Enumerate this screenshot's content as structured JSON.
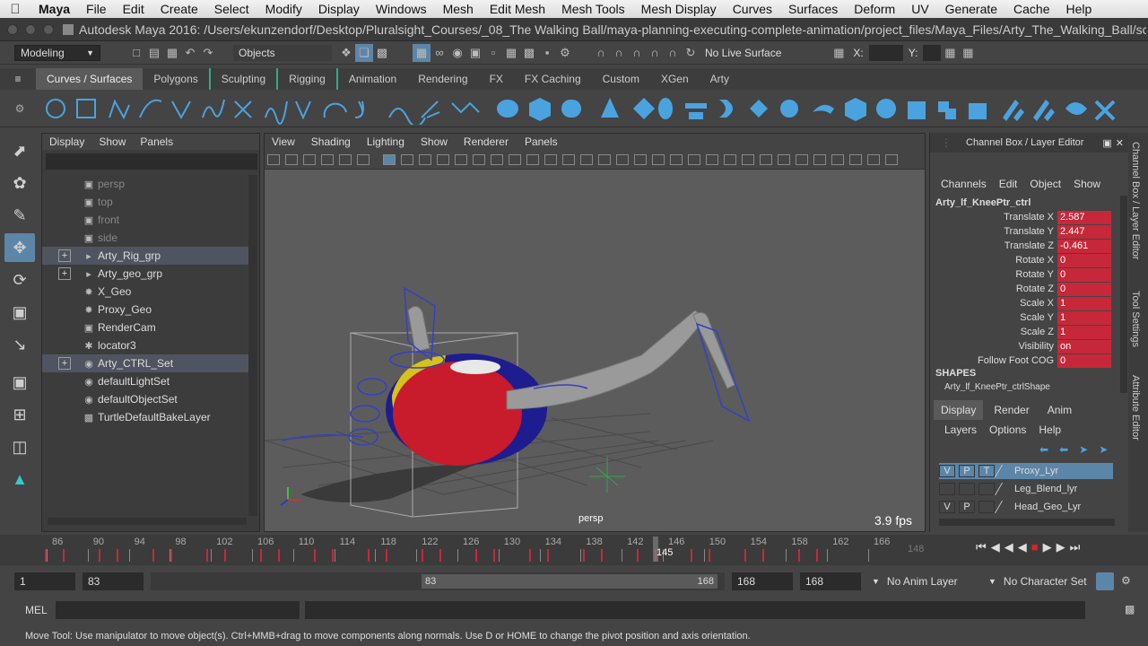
{
  "mac_menu": {
    "app_name": "Maya",
    "items": [
      "File",
      "Edit",
      "Create",
      "Select",
      "Modify",
      "Display",
      "Windows",
      "Mesh",
      "Edit Mesh",
      "Mesh Tools",
      "Mesh Display",
      "Curves",
      "Surfaces",
      "Deform",
      "UV",
      "Generate",
      "Cache",
      "Help"
    ]
  },
  "window": {
    "title": "Autodesk Maya 2016: /Users/ekunzendorf/Desktop/Pluralsight_Courses/_08_The Walking Ball/maya-planning-executing-complete-animation/project_files/Maya_Files/Arty_The_Walking_Ball/scen..."
  },
  "status_line": {
    "menu_set": "Modeling",
    "selection_mode": "Objects",
    "live_surface": "No Live Surface",
    "x_label": "X:",
    "y_label": "Y:"
  },
  "shelf": {
    "tabs": [
      "Curves / Surfaces",
      "Polygons",
      "Sculpting",
      "Rigging",
      "Animation",
      "Rendering",
      "FX",
      "FX Caching",
      "Custom",
      "XGen",
      "Arty"
    ],
    "active_tab": "Curves / Surfaces"
  },
  "outliner": {
    "menu": [
      "Display",
      "Show",
      "Panels"
    ],
    "items": [
      {
        "label": "persp",
        "icon": "camera-icon",
        "dim": true,
        "expand": false,
        "selected": false
      },
      {
        "label": "top",
        "icon": "camera-icon",
        "dim": true,
        "expand": false,
        "selected": false
      },
      {
        "label": "front",
        "icon": "camera-icon",
        "dim": true,
        "expand": false,
        "selected": false
      },
      {
        "label": "side",
        "icon": "camera-icon",
        "dim": true,
        "expand": false,
        "selected": false
      },
      {
        "label": "Arty_Rig_grp",
        "icon": "group-icon",
        "dim": false,
        "expand": true,
        "selected": true
      },
      {
        "label": "Arty_geo_grp",
        "icon": "group-icon",
        "dim": false,
        "expand": true,
        "selected": false
      },
      {
        "label": "X_Geo",
        "icon": "mesh-icon",
        "dim": false,
        "expand": false,
        "selected": false
      },
      {
        "label": "Proxy_Geo",
        "icon": "mesh-icon",
        "dim": false,
        "expand": false,
        "selected": false
      },
      {
        "label": "RenderCam",
        "icon": "camera-icon",
        "dim": false,
        "expand": false,
        "selected": false
      },
      {
        "label": "locator3",
        "icon": "locator-icon",
        "dim": false,
        "expand": false,
        "selected": false
      },
      {
        "label": "Arty_CTRL_Set",
        "icon": "set-icon",
        "dim": false,
        "expand": true,
        "selected": true
      },
      {
        "label": "defaultLightSet",
        "icon": "set-icon",
        "dim": false,
        "expand": false,
        "selected": false
      },
      {
        "label": "defaultObjectSet",
        "icon": "set-icon",
        "dim": false,
        "expand": false,
        "selected": false
      },
      {
        "label": "TurtleDefaultBakeLayer",
        "icon": "layer-icon",
        "dim": false,
        "expand": false,
        "selected": false
      }
    ]
  },
  "viewport": {
    "menu": [
      "View",
      "Shading",
      "Lighting",
      "Show",
      "Renderer",
      "Panels"
    ],
    "camera": "persp",
    "fps": "3.9 fps"
  },
  "channel_box": {
    "title": "Channel Box / Layer Editor",
    "menu": [
      "Channels",
      "Edit",
      "Object",
      "Show"
    ],
    "node": "Arty_lf_KneePtr_ctrl",
    "channels": [
      {
        "label": "Translate X",
        "value": "2.587"
      },
      {
        "label": "Translate Y",
        "value": "2.447"
      },
      {
        "label": "Translate Z",
        "value": "-0.461"
      },
      {
        "label": "Rotate X",
        "value": "0"
      },
      {
        "label": "Rotate Y",
        "value": "0"
      },
      {
        "label": "Rotate Z",
        "value": "0"
      },
      {
        "label": "Scale X",
        "value": "1"
      },
      {
        "label": "Scale Y",
        "value": "1"
      },
      {
        "label": "Scale Z",
        "value": "1"
      },
      {
        "label": "Visibility",
        "value": "on"
      },
      {
        "label": "Follow Foot COG",
        "value": "0"
      }
    ],
    "shapes_header": "SHAPES",
    "shape_name": "Arty_lf_KneePtr_ctrlShape",
    "layer_tabs": [
      "Display",
      "Render",
      "Anim"
    ],
    "active_layer_tab": "Display",
    "layer_menu": [
      "Layers",
      "Options",
      "Help"
    ],
    "layers": [
      {
        "name": "Proxy_Lyr",
        "v": "V",
        "p": "P",
        "t": "T",
        "selected": true
      },
      {
        "name": "Leg_Blend_lyr",
        "v": "",
        "p": "",
        "t": "",
        "selected": false
      },
      {
        "name": "Head_Geo_Lyr",
        "v": "V",
        "p": "P",
        "t": "",
        "selected": false
      }
    ],
    "side_tabs": [
      "Channel Box / Layer Editor",
      "Tool Settings",
      "Attribute Editor"
    ]
  },
  "timeline": {
    "ticks": [
      "86",
      "90",
      "94",
      "98",
      "102",
      "106",
      "110",
      "114",
      "118",
      "122",
      "126",
      "130",
      "134",
      "138",
      "142",
      "146",
      "150",
      "154",
      "158",
      "162",
      "166"
    ],
    "current_frame": "145",
    "end_field": "148"
  },
  "range": {
    "start": "1",
    "range_start": "83",
    "slider_start": "83",
    "slider_end": "168",
    "range_end": "168",
    "end": "168",
    "anim_layer": "No Anim Layer",
    "character_set": "No Character Set"
  },
  "command_line": {
    "label": "MEL"
  },
  "help_line": {
    "text": "Move Tool: Use manipulator to move object(s). Ctrl+MMB+drag to move components along normals. Use D or HOME to change the pivot position and axis orientation."
  },
  "colors": {
    "channel_value_bg": "#c6283a",
    "selection_blue": "#5c86a8",
    "key_tick": "#c8283a",
    "shelf_icon": "#4aa3df"
  }
}
